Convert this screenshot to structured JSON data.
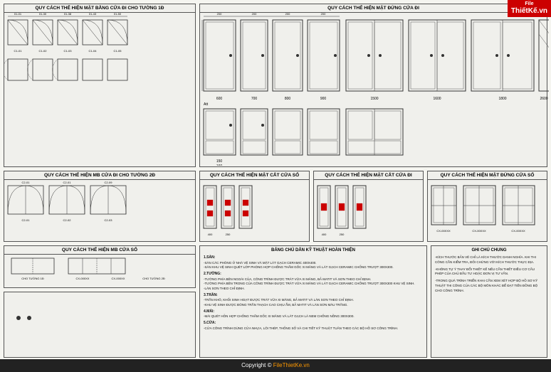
{
  "logo": {
    "top": "File",
    "main": "ThiếtKế.vn",
    "url_display": "FileThietKe.vn"
  },
  "sections": {
    "top_left_title": "QUY CÁCH THỂ HIỆN MẶT BẰNG CỬA ĐI CHO TƯỜNG 1Đ",
    "top_left_title2": "QUY CÁCH THỂ HIỆN MB CỬA ĐI CHO TƯỜNG 2Đ",
    "top_right_title": "QUY CÁCH THỂ HIỆN MẶT ĐỨNG CỬA ĐI",
    "mid_left_title": "QUY CÁCH THỂ HIỆN MB CỬA SỔ",
    "mid_center1_title": "QUY CÁCH THỂ HIỆN MẶT CẮT CỬA SỔ",
    "mid_center2_title": "QUY CÁCH THỂ HIỆN MẶT CẮT CỬA ĐI",
    "mid_right_title": "QUY CÁCH THỂ HIỆN MẶT ĐỨNG CỬA SỔ",
    "bang_chu_dan_title": "BẢNG CHÚ DẪN KỸ THUẬT HOÀN THIỆN",
    "ghi_chu_title": "GHI CHÚ CHUNG"
  },
  "bang_chu_dan": {
    "title": "BẢNG CHÚ DẪN KỸ THUẬT HOÀN THIỆN",
    "items": [
      "1.SÀN:",
      "-SÀN CÁC PHÒNG Ở NHÀ VỆ SINH VÀ MẶT LÁT GẠCH CERAMIC 400X400.",
      "-SÀN KHU VỆ SINH QUÉT LỚP PHÒNG HỢP CHỐNG THẤM GỐC XI MĂNG VÀ LÁT GẠCH",
      " CERAMIC CHỐNG TRƯỢT 300X300.",
      "2.TƯỜNG:",
      "-TƯỜNG PHÍA BÊN NGOÀI CỦA, CÔNG TRÌNH ĐƯỢC TRÁT VỮA XI MĂNG, BẢ MATIT VÀ",
      " SƠN THEO CHỈ ĐỊNH.",
      "-TƯỜNG PHÍA BÊN TRONG CỦA CÔNG TRÌNH ĐƯỢC TRÁT VỮA XI MĂNG VÀ LÁT GẠCH",
      " CERAMIC 300X300 KHU VỆ SINH.",
      "-LÀN SƠN THEO CHỈ ĐỊNH.",
      "3.TRẦN:",
      "-TRẦN KHÔ, KHỐI SINH HOẠT ĐƯỢC TRÁT VỮA XI MĂNG, BẢ MATIT VÀ LÀN SƠN",
      " THEO CHỈ ĐỊNH.",
      "-KHU VỆ SINH ĐƯỢC ĐÓNG TRẦN THẠCH CAO CHỊU ẨM, BẢ MATIT VÀ LÀN SƠN MÀU",
      " TRẮNG.",
      "4.MÁI:",
      "-MÁI QUÉT HỖN HỢP CHỐNG THẤM GỐC XI MĂNG VÀ LÁT GẠCH LÁ NEM CHỐNG NỒNG",
      " 300X300.",
      "5.CỬA:",
      "-CỬA CÔNG TRÌNH DÙNG CỬA NHỰA, LÕI THÉP, THỐNG SỐ VÀ CHI TIẾT KỸ THUẬT TUÂN",
      " THEO CÁC BỘ HỒ SƠ CÔNG TRÌNH."
    ]
  },
  "ghi_chu": {
    "title": "GHI CHÚ CHUNG",
    "items": [
      "-KÍCH THƯỚC BẢN VẼ CHỈ LÀ KÍCH THƯỚC DANH NGHĨA.",
      " KHI THI CÔNG CẦN KIỂM TRA, ĐỐI CHỨNG VỚI KÍCH THƯỚC THỰC ĐỊA.",
      "-KHÔNG TỰ Ý THAY ĐỔI THIẾT KẾ NẾU CẦN THIẾT ĐIỀU CƠ CẤU",
      " PHÉP CỦA CHỦ ĐẦU TƯ HOẶC ĐƠN VỊ TƯ VẤN.",
      "-TRONG QUÁ TRÌNH TRIỂN KHAI CẦN XEM XÉT HỢP BỘ HỒ SƠ KỸ THUẬT THI CÔNG CỦA CÁC BỘ",
      " MÔN KHÁC ĐỂ ĐẠT TIẾN ĐỒNG BỘ CHO CÔNG TRÌNH."
    ]
  },
  "copyright": "Copyright © FileThietKe.vn",
  "watermark": "Att"
}
